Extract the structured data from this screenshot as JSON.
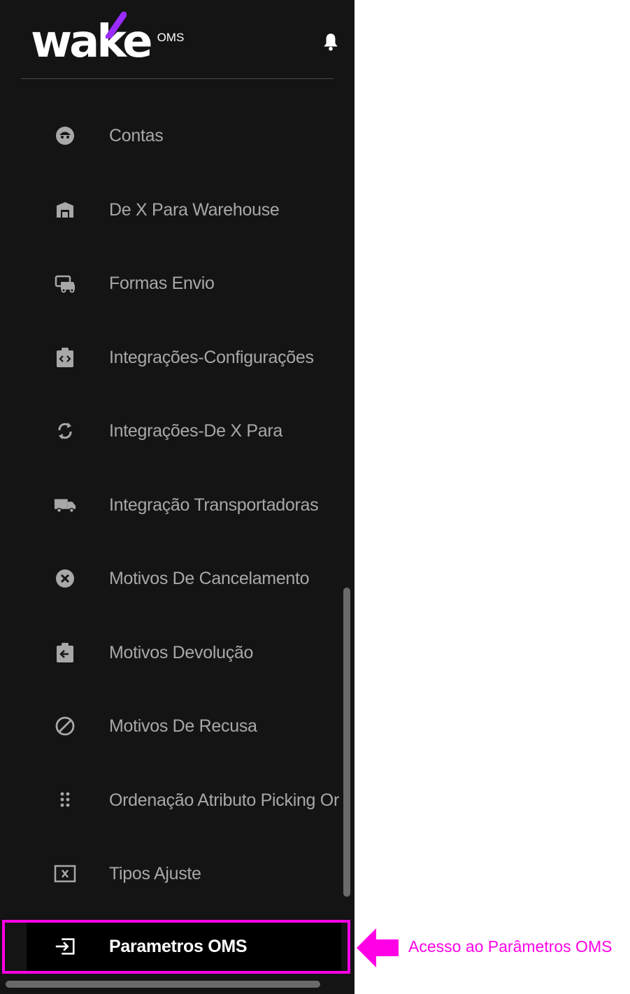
{
  "brand": {
    "logo_word": "wake",
    "logo_sub": "OMS",
    "accent_color": "#9b2cff"
  },
  "header": {
    "bell_icon": "bell-icon"
  },
  "menu": {
    "items": [
      {
        "label": "Contas",
        "icon": "account-circle-icon"
      },
      {
        "label": "De X Para Warehouse",
        "icon": "warehouse-icon"
      },
      {
        "label": "Formas Envio",
        "icon": "car-shipping-icon"
      },
      {
        "label": "Integrações-Configurações",
        "icon": "clipboard-code-icon"
      },
      {
        "label": "Integrações-De X Para",
        "icon": "sync-icon"
      },
      {
        "label": "Integração Transportadoras",
        "icon": "truck-icon"
      },
      {
        "label": "Motivos De Cancelamento",
        "icon": "cancel-circle-icon"
      },
      {
        "label": "Motivos Devolução",
        "icon": "clipboard-return-icon"
      },
      {
        "label": "Motivos De Recusa",
        "icon": "block-icon"
      },
      {
        "label": "Ordenação Atributo Picking Or",
        "icon": "drag-dots-icon"
      },
      {
        "label": "Tipos Ajuste",
        "icon": "box-x-icon"
      },
      {
        "label": "Parametros OMS",
        "icon": "login-icon",
        "active": true
      }
    ]
  },
  "annotation": {
    "text": "Acesso ao Parâmetros OMS",
    "color": "#ff00e6"
  },
  "colors": {
    "sidebar_bg": "#141414",
    "active_bg": "#000000",
    "label_color": "#a8a8a8",
    "active_label_color": "#ffffff"
  }
}
